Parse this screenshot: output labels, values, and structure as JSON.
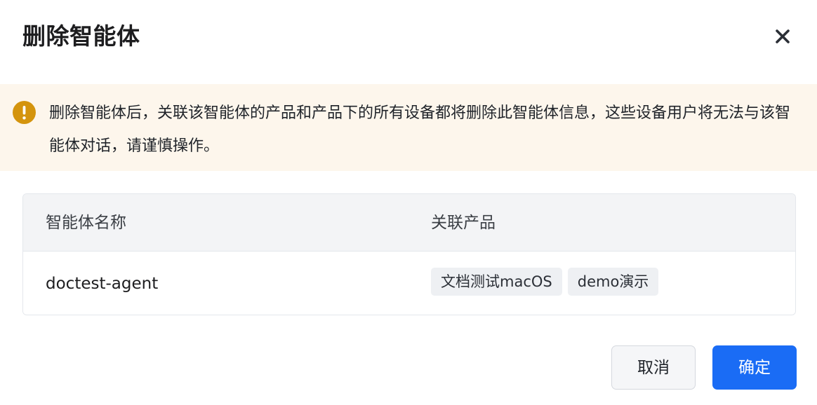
{
  "dialog": {
    "title": "删除智能体",
    "close_icon": "close-icon"
  },
  "warning": {
    "icon": "exclamation-circle-icon",
    "color": "#d4940d",
    "background": "#fdf6ec",
    "text": "删除智能体后，关联该智能体的产品和产品下的所有设备都将删除此智能体信息，这些设备用户将无法与该智能体对话，请谨慎操作。"
  },
  "table": {
    "columns": [
      "智能体名称",
      "关联产品"
    ],
    "rows": [
      {
        "name": "doctest-agent",
        "products": [
          "文档测试macOS",
          "demo演示"
        ]
      }
    ]
  },
  "footer": {
    "cancel_label": "取消",
    "confirm_label": "确定",
    "confirm_color": "#1a6cf5"
  }
}
